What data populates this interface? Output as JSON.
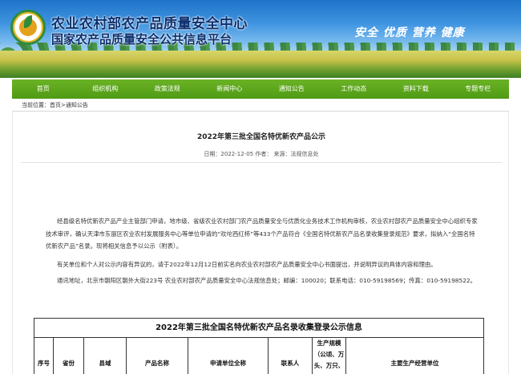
{
  "header": {
    "org_name": "农业农村部农产品质量安全中心",
    "platform_name": "国家农产品质量安全公共信息平台",
    "slogan": "安全 优质 营养 健康"
  },
  "nav": {
    "items": [
      "首页",
      "组织机构",
      "政策法规",
      "新闻中心",
      "通知公告",
      "工作动态",
      "资料下载",
      "专题专栏"
    ]
  },
  "breadcrumb": {
    "prefix": "当前位置：",
    "path": "首页>通知公告"
  },
  "article": {
    "title": "2022年第三批全国名特优新农产品公示",
    "meta": "日期：2022-12-05 作者： 来源：法规信息处",
    "paragraphs": [
      "经县级名特优新农产品产业主管部门申请，地市级、省级农业农村部门农产品质量安全与优质化业务技术工作机构审核，农业农村部农产品质量安全中心组织专家技术审评，确认天津市东丽区农业农村发展服务中心等单位申请的“欢坨西红柿”等433个产品符合《全国名特优新农产品名录收集登录规范》要求，拟纳入“全国名特优新农产品”名录。现将相关信息予以公示（附表）。",
      "有关单位和个人对公示内容有异议的，请于2022年12月12日前实名向农业农村部农产品质量安全中心书面提出，并说明异议的具体内容和理由。",
      "通讯地址，北京市朝阳区朝外大街223号 农业农村部农产品质量安全中心法规信息处；邮编：100020；联系电话：010-59198569；传真：010-59198522。"
    ]
  },
  "table": {
    "title": "2022年第三批全国名特优新农产品名录收集登录公示信息",
    "columns": [
      "序号",
      "省份",
      "县域",
      "产品名称",
      "申请单位全称",
      "联系人",
      "生产规模（公顷、万头、万只、",
      "主要生产经营单位"
    ]
  }
}
